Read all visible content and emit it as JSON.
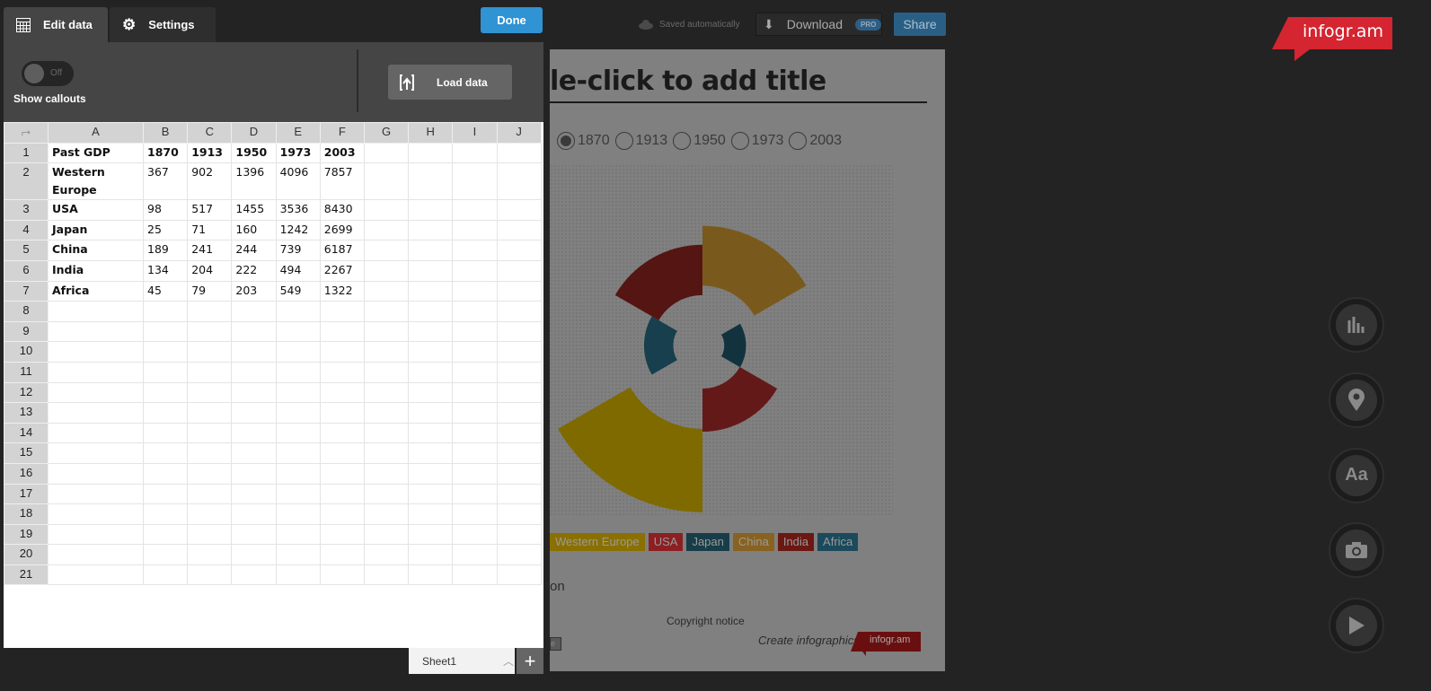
{
  "topbar": {
    "saved": "Saved automatically",
    "download": "Download",
    "pro": "PRO",
    "share": "Share",
    "logo": "infogr.am",
    "cloud_icon": "cloud-icon",
    "download_icon": "arrow-down-icon"
  },
  "card": {
    "title": "le-click to add title",
    "radio_options": [
      {
        "label": "1870",
        "selected": true
      },
      {
        "label": "1913",
        "selected": false
      },
      {
        "label": "1950",
        "selected": false
      },
      {
        "label": "1973",
        "selected": false
      },
      {
        "label": "2003",
        "selected": false
      }
    ],
    "legend": [
      {
        "label": "Western Europe",
        "color": "#8a7000"
      },
      {
        "label": "USA",
        "color": "#8b1f22"
      },
      {
        "label": "Japan",
        "color": "#173d49"
      },
      {
        "label": "China",
        "color": "#876220"
      },
      {
        "label": "India",
        "color": "#6b1712"
      },
      {
        "label": "Africa",
        "color": "#1b4a5c"
      }
    ],
    "source_fragment": "on",
    "copyright": "Copyright notice",
    "create": "Create infographics",
    "create_logo": "infogr.am",
    "button_fragment": "e"
  },
  "chart_data": {
    "type": "polar-area",
    "selected_year": "1870",
    "title": "",
    "categories": [
      "China",
      "Japan",
      "USA",
      "Western Europe",
      "Africa",
      "India"
    ],
    "values": [
      189,
      25,
      98,
      367,
      45,
      134
    ],
    "colors": [
      "#7a5a1c",
      "#12333e",
      "#641919",
      "#7f6a00",
      "#173f4e",
      "#551512"
    ]
  },
  "tools": [
    {
      "name": "chart-icon"
    },
    {
      "name": "map-pin-icon"
    },
    {
      "name": "text-icon",
      "glyph": "Aa"
    },
    {
      "name": "camera-icon"
    },
    {
      "name": "play-icon"
    }
  ],
  "panel": {
    "tabs": [
      {
        "label": "Edit data",
        "icon": "table-icon"
      },
      {
        "label": "Settings",
        "icon": "gear-icon"
      }
    ],
    "done": "Done",
    "toggle_state": "Off",
    "show_callouts": "Show callouts",
    "load_data": "Load data",
    "columns": [
      "A",
      "B",
      "C",
      "D",
      "E",
      "F",
      "G",
      "H",
      "I",
      "J"
    ],
    "rows": [
      [
        "Past GDP",
        "1870",
        "1913",
        "1950",
        "1973",
        "2003"
      ],
      [
        "Western Europe",
        "367",
        "902",
        "1396",
        "4096",
        "7857"
      ],
      [
        "USA",
        "98",
        "517",
        "1455",
        "3536",
        "8430"
      ],
      [
        "Japan",
        "25",
        "71",
        "160",
        "1242",
        "2699"
      ],
      [
        "China",
        "189",
        "241",
        "244",
        "739",
        "6187"
      ],
      [
        "India",
        "134",
        "204",
        "222",
        "494",
        "2267"
      ],
      [
        "Africa",
        "45",
        "79",
        "203",
        "549",
        "1322"
      ]
    ],
    "row_count": 21,
    "sheet": "Sheet1",
    "add_sheet": "+"
  }
}
